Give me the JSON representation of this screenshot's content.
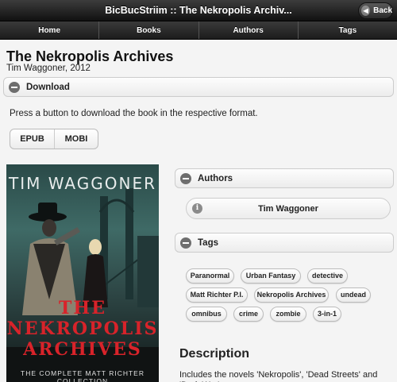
{
  "header": {
    "title": "BicBucStriim :: The Nekropolis Archiv...",
    "back_label": "Back"
  },
  "nav": [
    "Home",
    "Books",
    "Authors",
    "Tags"
  ],
  "book": {
    "title": "The Nekropolis Archives",
    "subtitle": "Tim Waggoner, 2012"
  },
  "download": {
    "heading": "Download",
    "text": "Press a button to download the book in the respective format.",
    "formats": [
      "EPUB",
      "MOBI"
    ]
  },
  "cover": {
    "author": "TIM WAGGONER",
    "title_line1": "THE",
    "title_line2": "NEKROPOLIS",
    "title_line3": "ARCHIVES",
    "collection": "THE COMPLETE MATT RICHTER COLLECTION"
  },
  "authors": {
    "heading": "Authors",
    "items": [
      "Tim Waggoner"
    ]
  },
  "tags": {
    "heading": "Tags",
    "items": [
      "Paranormal",
      "Urban Fantasy",
      "detective",
      "Matt Richter P.I.",
      "Nekropolis Archives",
      "undead",
      "omnibus",
      "crime",
      "zombie",
      "3-in-1"
    ]
  },
  "description": {
    "heading": "Description",
    "text": "Includes the novels 'Nekropolis', 'Dead Streets' and 'Dark War'"
  },
  "icons": {
    "back": "back-arrow-icon",
    "collapse": "minus-icon",
    "info": "info-icon"
  }
}
